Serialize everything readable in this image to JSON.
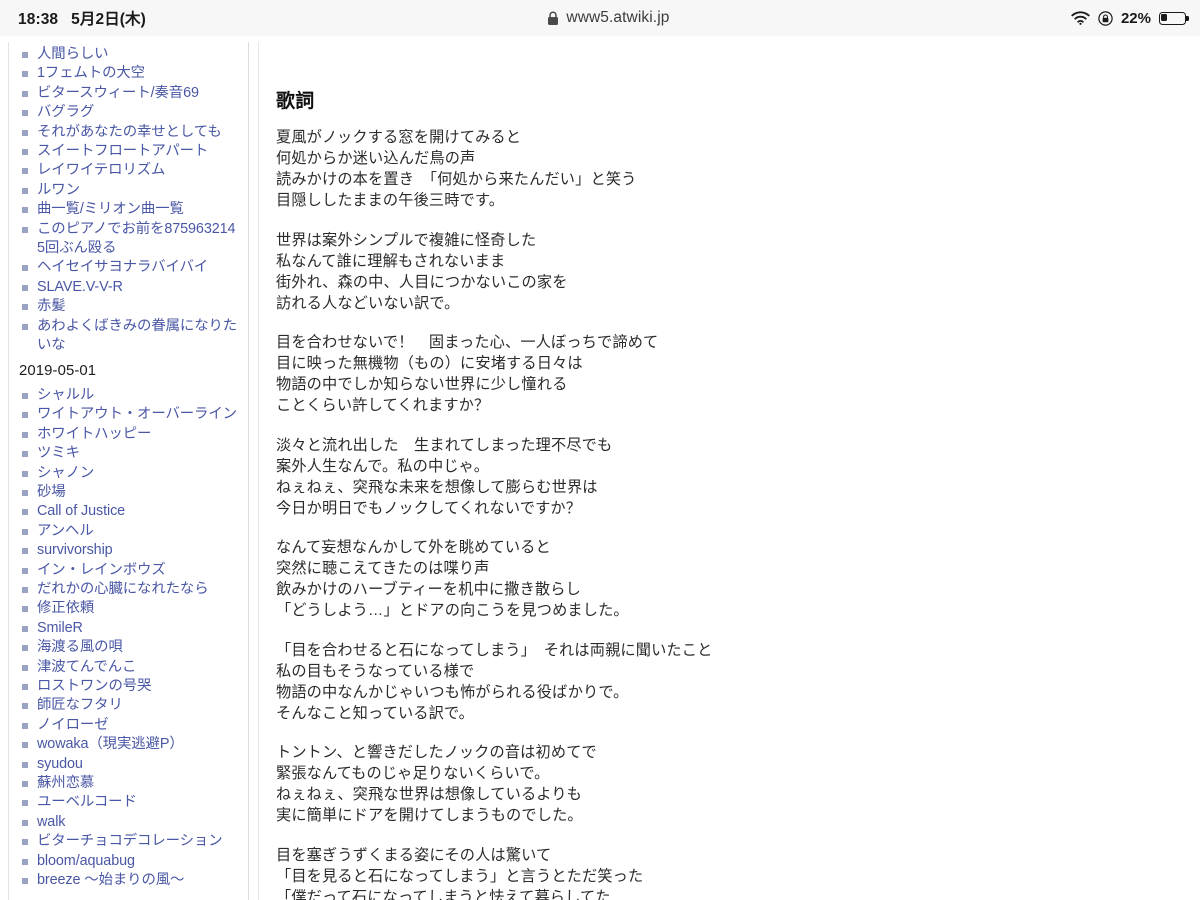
{
  "statusbar": {
    "time": "18:38",
    "date": "5月2日(木)",
    "url": "www5.atwiki.jp",
    "lock_icon": "lock-icon",
    "wifi_icon": "wifi-icon",
    "rotation_lock_icon": "rotation-lock-icon",
    "battery_percent_label": "22%",
    "battery_level": 22
  },
  "sidebar": {
    "groups": [
      {
        "heading": null,
        "items": [
          "人間らしい",
          "1フェムトの大空",
          "ビタースウィート/奏音69",
          "バグラグ",
          "それがあなたの幸せとしても",
          "スイートフロートアパート",
          "レイワイテロリズム",
          "ルワン",
          "曲一覧/ミリオン曲一覧",
          "このピアノでお前を8759632145回ぶん殴る",
          "ヘイセイサヨナラバイバイ",
          "SLAVE.V-V-R",
          "赤髪",
          "あわよくばきみの眷属になりたいな"
        ]
      },
      {
        "heading": "2019-05-01",
        "items": [
          "シャルル",
          "ワイトアウト・オーバーライン",
          "ホワイトハッピー",
          "ツミキ",
          "シャノン",
          "砂場",
          "Call of Justice",
          "アンヘル",
          "survivorship",
          "イン・レインボウズ",
          "だれかの心臓になれたなら",
          "修正依頼",
          "SmileR",
          "海渡る風の唄",
          "津波てんでんこ",
          "ロストワンの号哭",
          "師匠なフタリ",
          "ノイローゼ",
          "wowaka（現実逃避P）",
          "syudou",
          "蘇州恋慕",
          "ユーベルコード",
          "walk",
          "ビターチョコデコレーション",
          "bloom/aquabug",
          "breeze 〜始まりの風〜"
        ]
      }
    ]
  },
  "main": {
    "title": "歌詞",
    "stanzas": [
      [
        "夏風がノックする窓を開けてみると",
        "何処からか迷い込んだ鳥の声",
        "読みかけの本を置き　「何処から来たんだい」と笑う",
        "目隠ししたままの午後三時です。"
      ],
      [
        "世界は案外シンプルで複雑に怪奇した",
        "私なんて誰に理解もされないまま",
        "街外れ、森の中、人目につかないこの家を",
        "訪れる人などいない訳で。"
      ],
      [
        "目を合わせないで！　固まった心、一人ぼっちで諦めて",
        "目に映った無機物（もの）に安堵する日々は",
        "物語の中でしか知らない世界に少し憧れる",
        "ことくらい許してくれますか？"
      ],
      [
        "淡々と流れ出した　生まれてしまった理不尽でも",
        "案外人生なんで。私の中じゃ。",
        "ねぇねぇ、突飛な未来を想像して膨らむ世界は",
        "今日か明日でもノックしてくれないですか？"
      ],
      [
        "なんて妄想なんかして外を眺めていると",
        "突然に聴こえてきたのは喋り声",
        "飲みかけのハーブティーを机中に撒き散らし",
        "「どうしよう…」とドアの向こうを見つめました。"
      ],
      [
        "「目を合わせると石になってしまう」　それは両親に聞いたこと",
        "私の目もそうなっている様で",
        "物語の中なんかじゃいつも怖がられる役ばかりで。",
        "そんなこと知っている訳で。"
      ],
      [
        "トントン、と響きだしたノックの音は初めてで",
        "緊張なんてものじゃ足りないくらいで。",
        "ねぇねぇ、突飛な世界は想像しているよりも",
        "実に簡単にドアを開けてしまうものでした。"
      ],
      [
        "目を塞ぎうずくまる姿にその人は驚いて",
        "「目を見ると石になってしまう」と言うとただ笑った",
        "「僕だって石になってしまうと怯えて暮らしてた"
      ]
    ]
  },
  "colors": {
    "link": "#4a57a5",
    "bullet": "#9aa3c4",
    "statusbar_bg": "#f7f7f7",
    "text": "#2b2b2b"
  }
}
